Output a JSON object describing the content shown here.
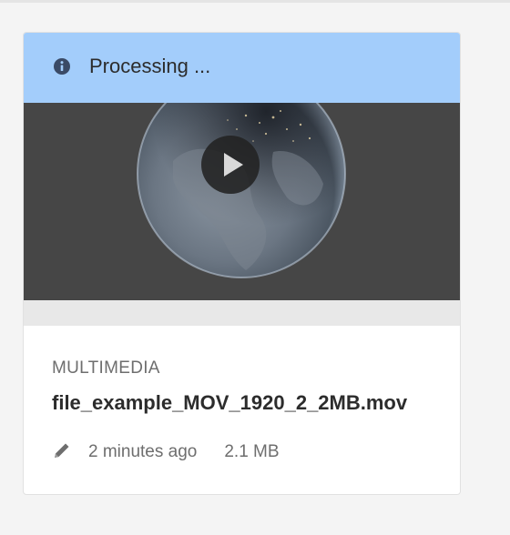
{
  "card": {
    "status": {
      "icon": "info-icon",
      "text": "Processing ..."
    },
    "preview": {
      "play_icon": "play-icon"
    },
    "asset_type": "MULTIMEDIA",
    "file_name": "file_example_MOV_1920_2_2MB.mov",
    "meta": {
      "edit_icon": "pencil-icon",
      "modified": "2 minutes ago",
      "size": "2.1 MB"
    }
  },
  "colors": {
    "banner": "#a3cdfb",
    "preview_bg": "#464646",
    "page_bg": "#f4f4f4"
  }
}
